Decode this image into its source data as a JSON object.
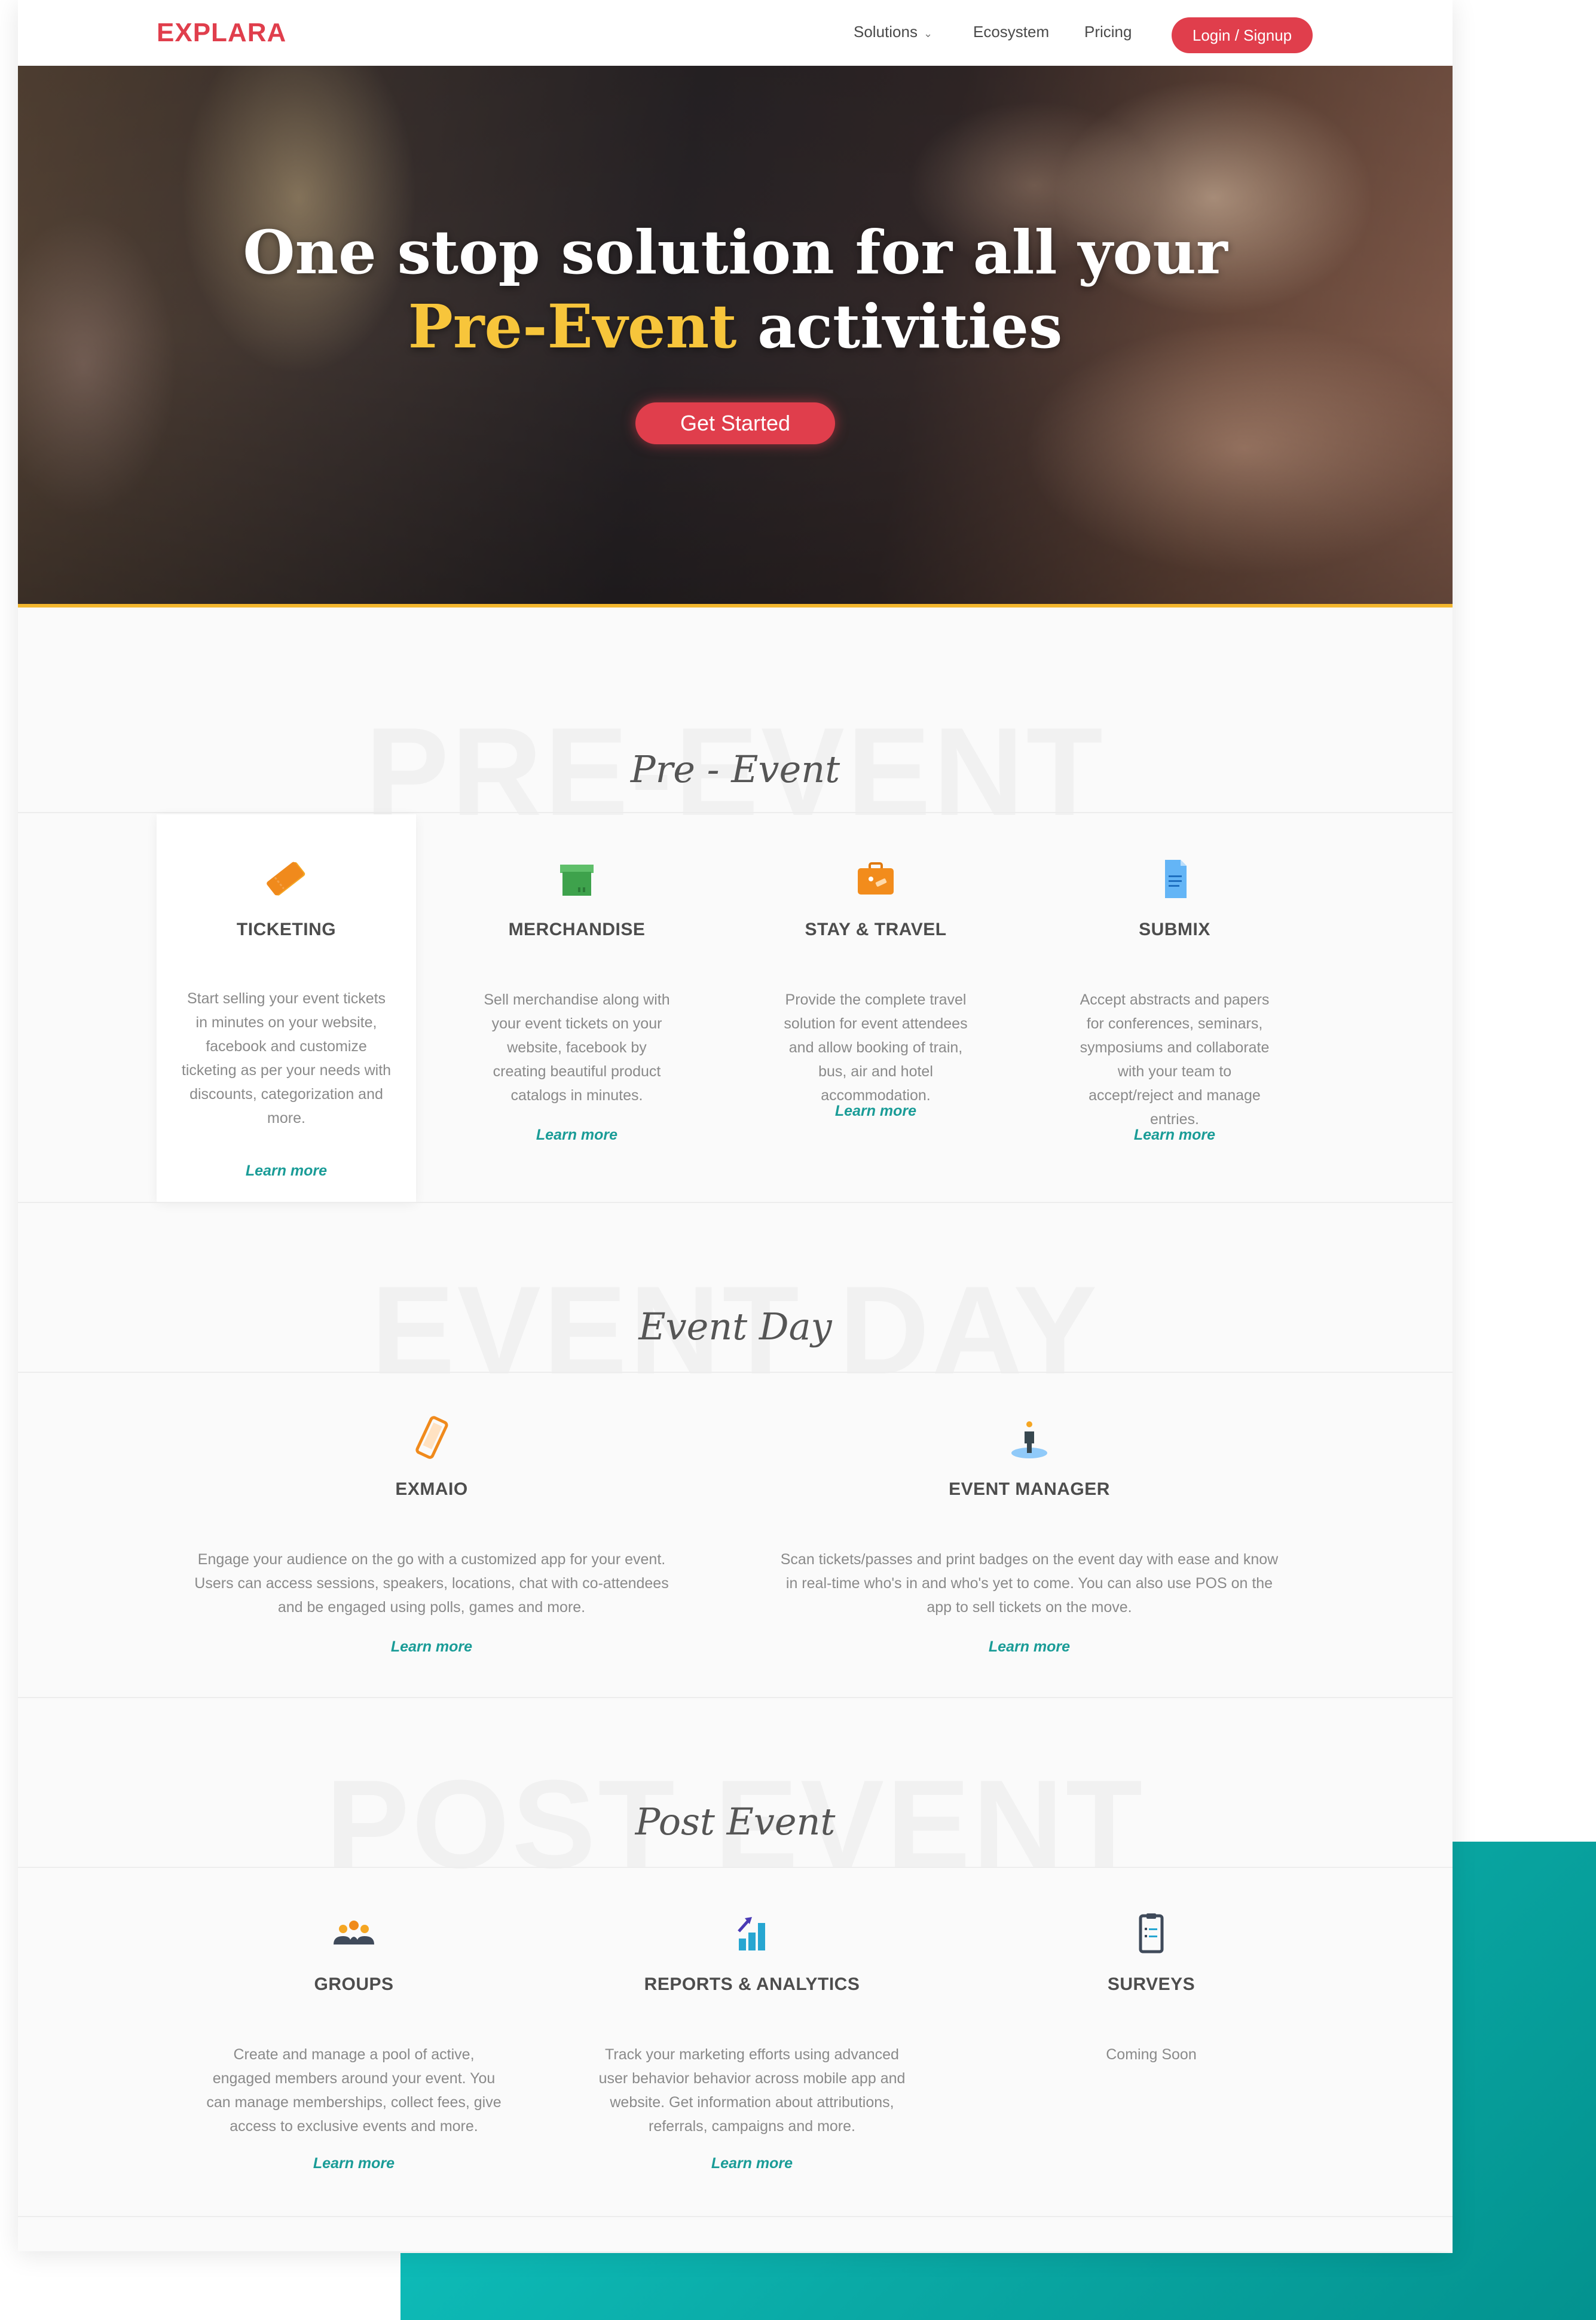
{
  "brand": {
    "logo_text": "EXPLARA",
    "accent": "#e03e4c",
    "teal": "#0aa9a5",
    "highlight": "#f7c53b"
  },
  "nav": {
    "solutions": "Solutions",
    "ecosystem": "Ecosystem",
    "pricing": "Pricing",
    "login": "Login / Signup"
  },
  "hero": {
    "line1": "One stop solution for all your",
    "highlight": "Pre-Event",
    "line2_rest": " activities",
    "cta": "Get Started"
  },
  "pre_event": {
    "watermark": "PRE-EVENT",
    "title": "Pre - Event",
    "cards": [
      {
        "icon": "ticket-icon",
        "title": "TICKETING",
        "desc": "Start selling your event tickets in minutes on your website, facebook and customize ticketing as per your needs with discounts, categorization and more.",
        "link": "Learn more"
      },
      {
        "icon": "box-icon",
        "title": "MERCHANDISE",
        "desc": "Sell merchandise along with your event tickets on your website, facebook by creating beautiful product catalogs in minutes.",
        "link": "Learn more"
      },
      {
        "icon": "suitcase-icon",
        "title": "STAY & TRAVEL",
        "desc": "Provide the complete travel solution for event attendees and allow booking of train, bus, air and hotel accommodation.",
        "link": "Learn more"
      },
      {
        "icon": "document-icon",
        "title": "SUBMIX",
        "desc": "Accept abstracts and papers for conferences, seminars, symposiums and collaborate with your team to accept/reject and manage entries.",
        "link": "Learn more"
      }
    ]
  },
  "event_day": {
    "watermark": "EVENT DAY",
    "title": "Event Day",
    "cards": [
      {
        "icon": "mobile-icon",
        "title": "EXMAIO",
        "desc": "Engage your audience on the go with a customized app for your event. Users can access sessions, speakers, locations, chat with co-attendees and be engaged using polls, games and more.",
        "link": "Learn more"
      },
      {
        "icon": "person-icon",
        "title": "EVENT MANAGER",
        "desc": "Scan tickets/passes and print badges on the event day with ease and know in real-time who's in and who's yet to come. You can also use POS on the app to sell tickets on the move.",
        "link": "Learn more"
      }
    ]
  },
  "post_event": {
    "watermark": "POST EVENT",
    "title": "Post Event",
    "cards": [
      {
        "icon": "group-icon",
        "title": "GROUPS",
        "desc": "Create and manage a pool of active, engaged members around your event. You can manage memberships, collect fees, give access to exclusive events and more.",
        "link": "Learn more"
      },
      {
        "icon": "bar-chart-icon",
        "title": "REPORTS & ANALYTICS",
        "desc": "Track your marketing efforts using advanced user behavior behavior across mobile app and website. Get information about attributions, referrals, campaigns and more.",
        "link": "Learn more"
      },
      {
        "icon": "clipboard-icon",
        "title": "SURVEYS",
        "desc": "Coming Soon"
      }
    ]
  }
}
